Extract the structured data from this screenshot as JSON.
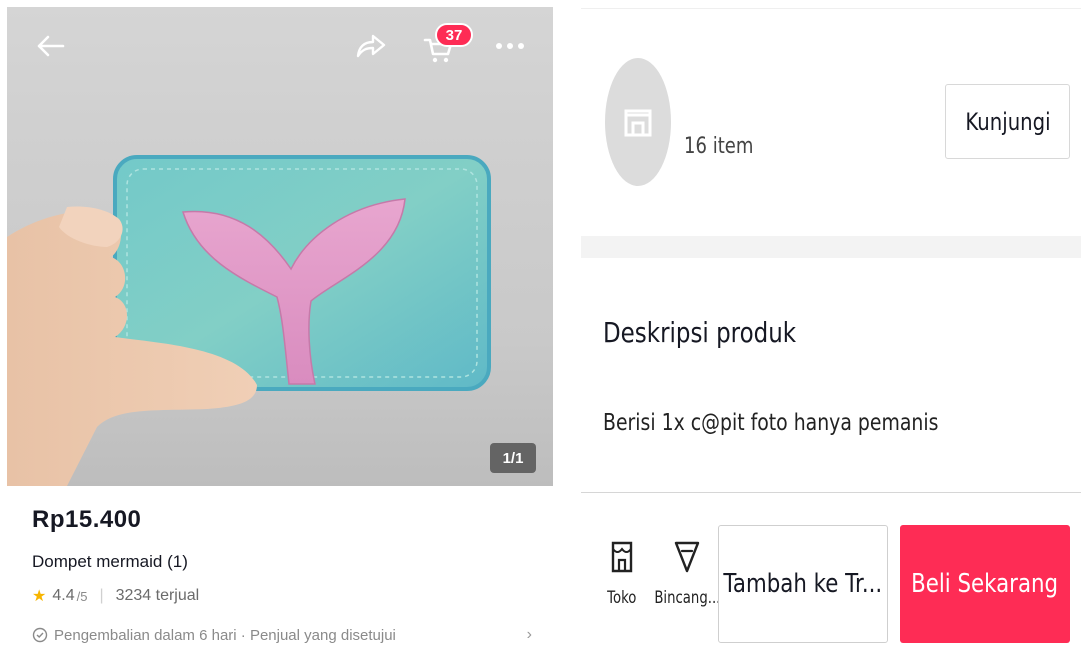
{
  "header": {
    "cart_count": "37"
  },
  "image": {
    "counter": "1/1"
  },
  "product": {
    "price": "Rp15.400",
    "title": "Dompet mermaid (1)",
    "rating": "4.4",
    "rating_scale": "/5",
    "sold": "3234 terjual",
    "return_policy": "Pengembalian dalam 6 hari · Penjual yang disetujui"
  },
  "shop": {
    "item_count": "16 item",
    "visit_label": "Kunjungi"
  },
  "description": {
    "heading": "Deskripsi produk",
    "text": "Berisi 1x c@pit foto hanya pemanis"
  },
  "actions": {
    "shop_label": "Toko",
    "chat_label": "Bincang...",
    "add_to_cart_label": "Tambah ke Tr...",
    "buy_now_label": "Beli Sekarang"
  },
  "colors": {
    "accent": "#fe2c55",
    "star": "#f7b500",
    "wallet": "#6fc4c8",
    "tail": "#e49ac6"
  }
}
